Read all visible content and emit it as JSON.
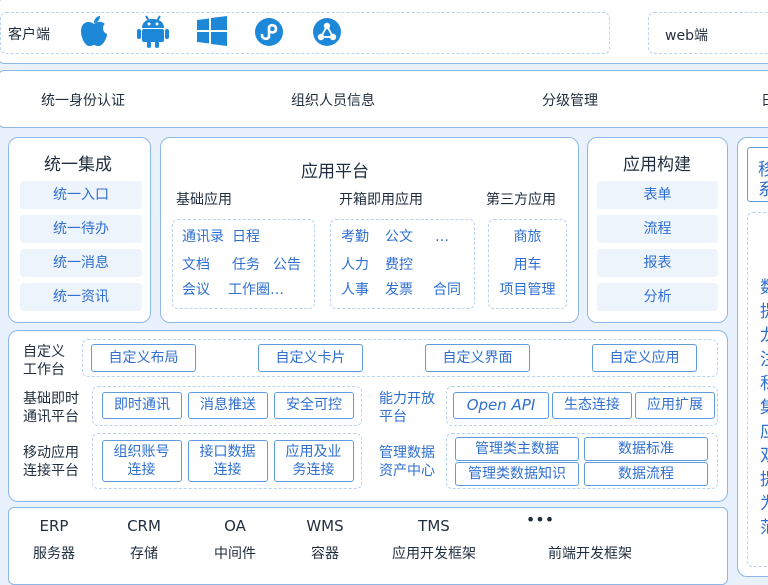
{
  "clients": {
    "label": "客户端",
    "icons": [
      "apple-icon",
      "android-icon",
      "windows-icon",
      "mini-program-icon",
      "share-icon"
    ],
    "web_label": "web端"
  },
  "identity_row": [
    "统一身份认证",
    "组织人员信息",
    "分级管理",
    "日"
  ],
  "integration": {
    "title": "统一集成",
    "items": [
      "统一入口",
      "统一待办",
      "统一消息",
      "统一资讯"
    ]
  },
  "app_platform": {
    "title": "应用平台",
    "base": {
      "title": "基础应用",
      "rows": [
        [
          "通讯录",
          "日程"
        ],
        [
          "文档",
          "任务",
          "公告"
        ],
        [
          "会议",
          "工作圈…"
        ]
      ]
    },
    "ready": {
      "title": "开箱即用应用",
      "rows": [
        [
          "考勤",
          "公文",
          "…"
        ],
        [
          "人力",
          "费控"
        ],
        [
          "人事",
          "发票",
          "合同"
        ]
      ]
    },
    "third": {
      "title": "第三方应用",
      "items": [
        "商旅",
        "用车",
        "项目管理"
      ]
    }
  },
  "app_build": {
    "title": "应用构建",
    "items": [
      "表单",
      "流程",
      "报表",
      "分析"
    ]
  },
  "right_panel": {
    "top_chars": [
      "移",
      "系"
    ],
    "side_chars": [
      "数",
      "提",
      "龙",
      "注",
      "私",
      "集",
      "应",
      "双",
      "提",
      "为",
      "范"
    ]
  },
  "capability": {
    "workbench": {
      "label_lines": [
        "自定义",
        "工作台"
      ],
      "items": [
        "自定义布局",
        "自定义卡片",
        "自定义界面",
        "自定义应用"
      ]
    },
    "im": {
      "label_lines": [
        "基础即时",
        "通讯平台"
      ],
      "items": [
        "即时通讯",
        "消息推送",
        "安全可控"
      ]
    },
    "open": {
      "label_lines": [
        "能力开放",
        "平台"
      ],
      "items": [
        "Open API",
        "生态连接",
        "应用扩展"
      ]
    },
    "mobile": {
      "label_lines": [
        "移动应用",
        "连接平台"
      ],
      "items": [
        [
          "组织账号",
          "连接"
        ],
        [
          "接口数据",
          "连接"
        ],
        [
          "应用及业",
          "务连接"
        ]
      ]
    },
    "data": {
      "label_lines": [
        "管理数据",
        "资产中心"
      ],
      "items": [
        "管理类主数据",
        "数据标准",
        "管理类数据知识",
        "数据流程"
      ]
    }
  },
  "infra": {
    "row1": [
      "ERP",
      "CRM",
      "OA",
      "WMS",
      "TMS",
      "•••"
    ],
    "row2": [
      "服务器",
      "存储",
      "中间件",
      "容器",
      "应用开发框架",
      "前端开发框架"
    ]
  }
}
